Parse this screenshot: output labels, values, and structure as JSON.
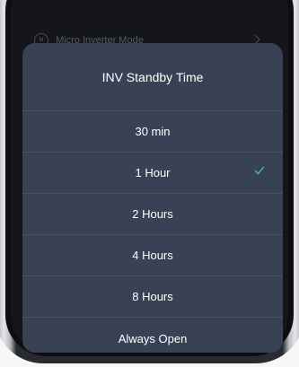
{
  "background": {
    "row_label": "Micro Inverter Mode",
    "row_icon": "circle-icon"
  },
  "sheet": {
    "title": "INV Standby Time",
    "options": [
      {
        "label": "30 min",
        "selected": false
      },
      {
        "label": "1 Hour",
        "selected": true
      },
      {
        "label": "2 Hours",
        "selected": false
      },
      {
        "label": "4 Hours",
        "selected": false
      },
      {
        "label": "8 Hours",
        "selected": false
      },
      {
        "label": "Always Open",
        "selected": false
      }
    ],
    "check_icon": "check-icon",
    "accent_color": "#3fc9b0",
    "sheet_color": "#394254"
  }
}
